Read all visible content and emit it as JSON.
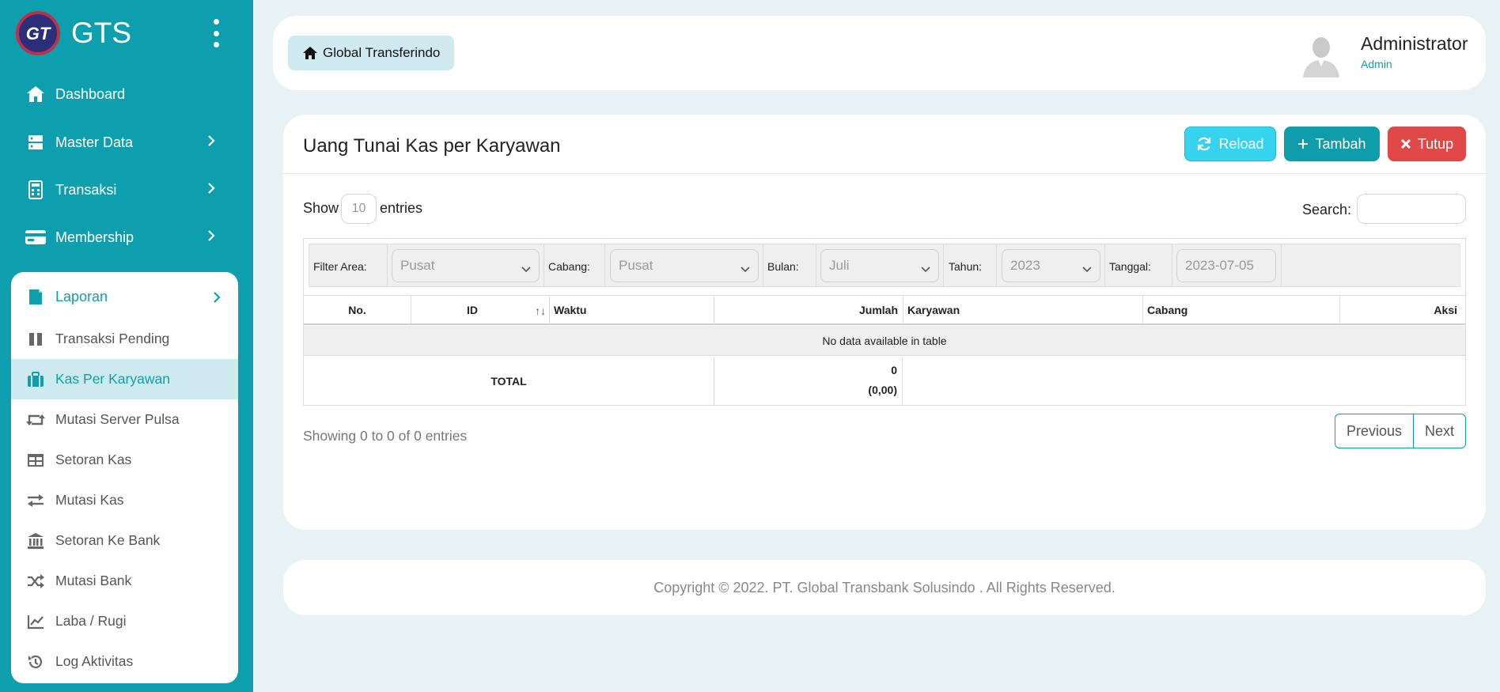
{
  "brand": {
    "name": "GTS",
    "logo_text": "GT"
  },
  "sidebar": {
    "items": [
      {
        "label": "Dashboard",
        "icon": "home-icon"
      },
      {
        "label": "Master Data",
        "icon": "server-icon"
      },
      {
        "label": "Transaksi",
        "icon": "calculator-icon"
      },
      {
        "label": "Membership",
        "icon": "credit-card-icon"
      }
    ],
    "laporan": {
      "label": "Laporan",
      "items": [
        {
          "label": "Transaksi Pending",
          "icon": "pause-icon"
        },
        {
          "label": "Kas Per Karyawan",
          "icon": "briefcase-icon",
          "active": true
        },
        {
          "label": "Mutasi Server Pulsa",
          "icon": "retweet-icon"
        },
        {
          "label": "Setoran Kas",
          "icon": "table-icon"
        },
        {
          "label": "Mutasi Kas",
          "icon": "exchange-icon"
        },
        {
          "label": "Setoran Ke Bank",
          "icon": "bank-icon"
        },
        {
          "label": "Mutasi Bank",
          "icon": "shuffle-icon"
        },
        {
          "label": "Laba / Rugi",
          "icon": "line-chart-icon"
        },
        {
          "label": "Log Aktivitas",
          "icon": "history-icon"
        }
      ]
    }
  },
  "header": {
    "breadcrumb": "Global Transferindo",
    "user_name": "Administrator",
    "user_role": "Admin"
  },
  "main": {
    "title": "Uang Tunai Kas per Karyawan",
    "buttons": {
      "reload": "Reload",
      "tambah": "Tambah",
      "tutup": "Tutup"
    },
    "show_label": "Show",
    "show_value": "10",
    "entries_label": "entries",
    "search_label": "Search:",
    "search_value": "",
    "filters": {
      "area_label": "Filter Area:",
      "area_value": "Pusat",
      "cabang_label": "Cabang:",
      "cabang_value": "Pusat",
      "bulan_label": "Bulan:",
      "bulan_value": "Juli",
      "tahun_label": "Tahun:",
      "tahun_value": "2023",
      "tanggal_label": "Tanggal:",
      "tanggal_value": "2023-07-05"
    },
    "columns": [
      "No.",
      "ID",
      "Waktu",
      "Jumlah",
      "Karyawan",
      "Cabang",
      "Aksi"
    ],
    "empty_message": "No data available in table",
    "total": {
      "label": "TOTAL",
      "count": "0",
      "amount": "(0,00)"
    },
    "info": "Showing 0 to 0 of 0 entries",
    "pagination": {
      "previous": "Previous",
      "next": "Next"
    }
  },
  "footer": {
    "copyright": "Copyright © 2022. PT. Global Transbank Solusindo . All Rights Reserved."
  },
  "colors": {
    "accent": "#0e9fae",
    "reload": "#36d3ee",
    "danger": "#e04848",
    "background": "#e8f1f3"
  }
}
